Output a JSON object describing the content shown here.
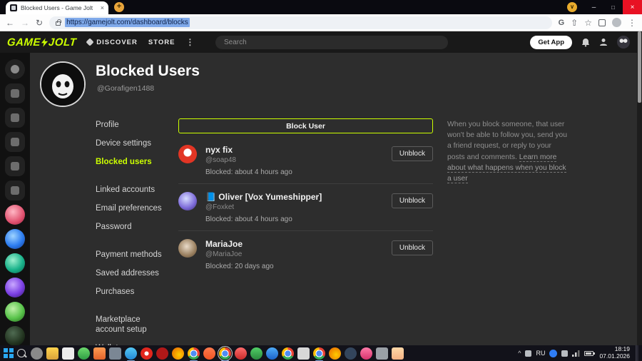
{
  "accent_color": "#ccff00",
  "icons": {
    "tab_close": "×",
    "new_tab": "+",
    "update_chevron": "∨",
    "minimize": "–",
    "maximize": "□",
    "window_close": "×",
    "back": "←",
    "forward": "→",
    "reload": "↻",
    "google": "G",
    "share": "⇧",
    "star": "☆",
    "menu_kebab": "⋮",
    "tray_caret": "^"
  },
  "browser": {
    "tab_title": "Blocked Users - Game Jolt",
    "url": "https://gamejolt.com/dashboard/blocks"
  },
  "gj_nav": {
    "logo_game": "GAME",
    "logo_jolt": "JOLT",
    "discover": "DISCOVER",
    "store": "STORE",
    "search_placeholder": "Search",
    "get_app": "Get App"
  },
  "page": {
    "title": "Blocked Users",
    "username": "@Gorafigen1488",
    "menu": [
      "Profile",
      "Device settings",
      "Blocked users",
      "Linked accounts",
      "Email preferences",
      "Password",
      "Payment methods",
      "Saved addresses",
      "Purchases",
      "Marketplace account setup",
      "Wallet"
    ],
    "block_user_button": "Block User",
    "blocked_users": [
      {
        "name": "nyx fix",
        "handle": "@soap48",
        "blocked_when": "Blocked: about 4 hours ago",
        "action": "Unblock"
      },
      {
        "name": "📘 Oliver [Vox Yumeshipper]",
        "handle": "@Foxket",
        "blocked_when": "Blocked: about 4 hours ago",
        "action": "Unblock"
      },
      {
        "name": "MariaJoe",
        "handle": "@MariaJoe",
        "blocked_when": "Blocked: 20 days ago",
        "action": "Unblock"
      }
    ],
    "info": {
      "text": "When you block someone, that user won't be able to follow you, send you a friend request, or reply to your posts and comments. ",
      "link": "Learn more about what happens when you block a user"
    }
  },
  "taskbar": {
    "language": "RU",
    "time": "18:19",
    "date": "07.01.2026"
  }
}
